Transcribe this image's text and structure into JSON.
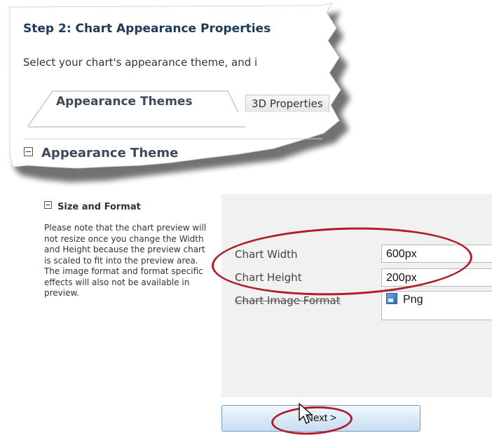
{
  "wizard": {
    "step_title": "Step 2: Chart Appearance Properties",
    "step_subtitle": "Select your chart's appearance theme, and i"
  },
  "tabs": [
    {
      "label": "Appearance Themes",
      "active": true
    },
    {
      "label": "3D Properties",
      "active": false
    }
  ],
  "appearance_section": {
    "title": "Appearance Theme"
  },
  "size_format": {
    "title": "Size and Format",
    "note": "Please note that the chart preview will not resize once you change the Width and Height because the preview chart is scaled to fit into the preview area. The image format and format specific effects will also not be available in preview."
  },
  "properties": {
    "width_label": "Chart Width",
    "width_value": "600px",
    "height_label": "Chart Height",
    "height_value": "200px",
    "format_label": "Chart Image Format",
    "format_value": "Png"
  },
  "buttons": {
    "next_label": "Next >"
  },
  "colors": {
    "highlight": "#b01c2a",
    "panel_bg": "#f1f1f1",
    "title_text": "#1f3a57",
    "button_top": "#f3f8fd",
    "button_bottom": "#c9ddf2"
  },
  "icons": [
    "collapse-icon",
    "png-file-icon",
    "mouse-pointer-icon"
  ]
}
